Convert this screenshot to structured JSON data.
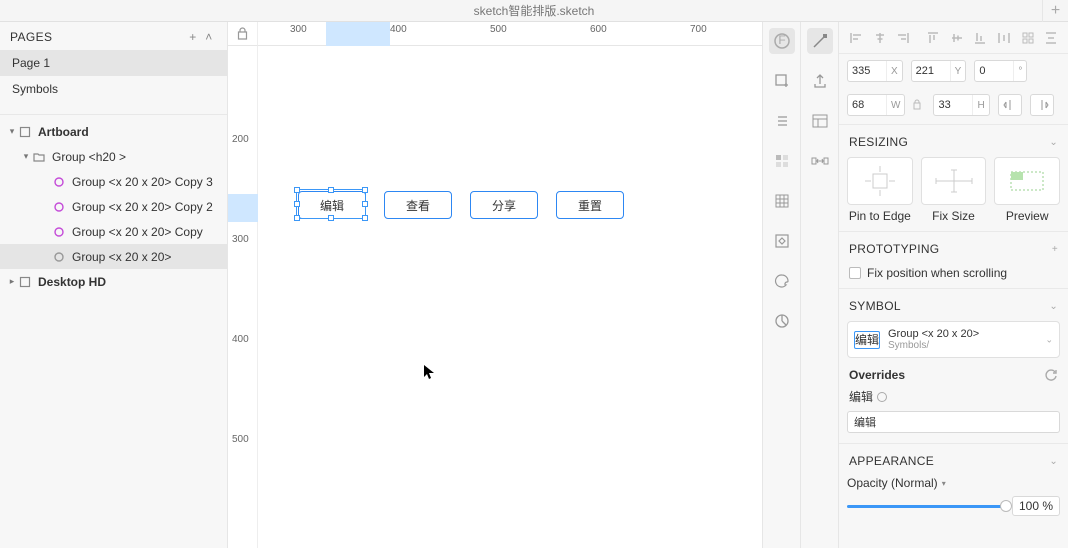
{
  "window": {
    "title": "sketch智能排版.sketch"
  },
  "pages": {
    "header": "PAGES",
    "items": [
      "Page 1",
      "Symbols"
    ],
    "selected": 0
  },
  "layers": {
    "artboard": "Artboard",
    "group": "Group <h20 >",
    "children": [
      "Group <x 20 x 20> Copy 3",
      "Group <x 20 x 20> Copy 2",
      "Group <x 20 x 20> Copy",
      "Group <x 20 x 20>"
    ],
    "selectedChild": 3,
    "desktop": "Desktop HD"
  },
  "ruler": {
    "h": [
      "300",
      "400",
      "500",
      "600",
      "700"
    ],
    "v": [
      "200",
      "300",
      "400",
      "500"
    ]
  },
  "canvas": {
    "buttons": [
      "编辑",
      "查看",
      "分享",
      "重置"
    ]
  },
  "inspector": {
    "x": "335",
    "y": "221",
    "rotation": "0",
    "w": "68",
    "h": "33",
    "resizing_header": "RESIZING",
    "resizing_labels": [
      "Pin to Edge",
      "Fix Size",
      "Preview"
    ],
    "prototyping_header": "PROTOTYPING",
    "fix_scroll_label": "Fix position when scrolling",
    "symbol_header": "SYMBOL",
    "symbol_name": "Group <x 20 x 20>",
    "symbol_category": "Symbols/",
    "symbol_thumb": "编辑",
    "overrides_header": "Overrides",
    "override_field_label": "编辑",
    "override_value": "编辑",
    "appearance_header": "APPEARANCE",
    "opacity_label": "Opacity (Normal)",
    "opacity_value": "100 %"
  }
}
